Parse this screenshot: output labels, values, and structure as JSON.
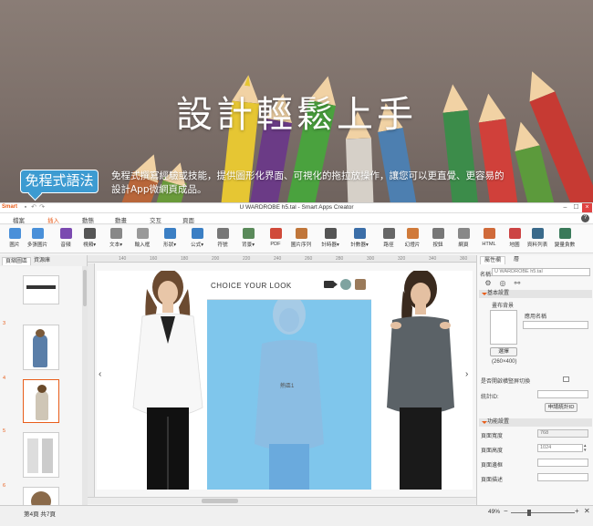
{
  "hero": {
    "title": "設計輕鬆上手",
    "badge": "免程式語法",
    "description_line1": "免程式撰寫經驗或技能，提供圖形化界面、可視化的拖拉放操作，讓您可以更直覺、更容易的",
    "description_line2": "設計App微網頁成品。"
  },
  "window": {
    "logo": "Smart",
    "title": "U WARDROBE h5.tal - Smart Apps Creator",
    "help_icon": "?"
  },
  "menu_tabs": [
    "檔案",
    "插入",
    "動態",
    "動畫",
    "交互",
    "頁面"
  ],
  "ribbon": [
    {
      "label": "圖片",
      "icon": "image-icon",
      "color": "#4a90d9"
    },
    {
      "label": "多張圖片",
      "icon": "images-icon",
      "color": "#4a90d9"
    },
    {
      "label": "音頻",
      "icon": "music-icon",
      "color": "#7b4ab0"
    },
    {
      "label": "視頻▾",
      "icon": "video-icon",
      "color": "#555555"
    },
    {
      "label": "文本▾",
      "icon": "text-icon",
      "color": "#888888"
    },
    {
      "label": "輸入框",
      "icon": "input-box-icon",
      "color": "#999999"
    },
    {
      "label": "形狀▾",
      "icon": "shape-icon",
      "color": "#3b7fc4"
    },
    {
      "label": "公式▾",
      "icon": "formula-icon",
      "color": "#3b7fc4"
    },
    {
      "label": "符號",
      "icon": "omega-icon",
      "color": "#777777"
    },
    {
      "label": "背景▾",
      "icon": "background-icon",
      "color": "#5a8a5a"
    },
    {
      "label": "PDF",
      "icon": "pdf-icon",
      "color": "#d04a3a"
    },
    {
      "label": "圖片序列",
      "icon": "image-sequence-icon",
      "color": "#c0763a"
    },
    {
      "label": "計時器▾",
      "icon": "timer-icon",
      "color": "#555555"
    },
    {
      "label": "計數器▾",
      "icon": "counter-icon",
      "color": "#3b6ea8"
    },
    {
      "label": "路徑",
      "icon": "path-icon",
      "color": "#666666"
    },
    {
      "label": "幻燈片",
      "icon": "slideshow-icon",
      "color": "#d07a3a"
    },
    {
      "label": "按鈕",
      "icon": "button-icon",
      "color": "#777777"
    },
    {
      "label": "網頁",
      "icon": "webpage-icon",
      "color": "#888888"
    },
    {
      "label": "HTML",
      "icon": "html-icon",
      "color": "#d06a3a"
    },
    {
      "label": "地圖",
      "icon": "map-icon",
      "color": "#cc4444"
    },
    {
      "label": "資料列表",
      "icon": "data-list-icon",
      "color": "#3a6a8a"
    },
    {
      "label": "變量貪數",
      "icon": "variable-icon",
      "color": "#3a7a5a"
    }
  ],
  "ruler_ticks": [
    "140",
    "160",
    "180",
    "200",
    "220",
    "240",
    "260",
    "280",
    "300",
    "320",
    "340",
    "360"
  ],
  "left_panel": {
    "tabs": [
      "頁縮圖區",
      "資源庫"
    ],
    "thumb_numbers": [
      "3",
      "4",
      "5",
      "6"
    ]
  },
  "stage": {
    "header_text": "CHOICE YOUR LOOK",
    "hotspot_label": "熱區1",
    "prev_arrow": "‹",
    "next_arrow": "›"
  },
  "right_panel": {
    "tabs": [
      "屬性欄",
      "層"
    ],
    "name_label": "名稱:",
    "name_value": "U WARDROBE h5.tal",
    "section_basic": "基本設置",
    "bg_label": "畫布背景",
    "app_name_label": "應用名稱",
    "choose_button": "選擇",
    "size_hint": "(260×400)",
    "landscape_label": "是否開啟橫豎屏切換",
    "stat_id_label": "統計ID:",
    "get_stat_button": "申請統計ID",
    "section_func": "功能設置",
    "width_label": "頁面寬度",
    "width_value": "768",
    "height_label": "頁面高度",
    "height_value": "1024",
    "margin_label": "頁面邊框",
    "desc_label": "頁面描述"
  },
  "status": {
    "page_info": "第4頁  共7頁",
    "zoom": "49%"
  },
  "colors": {
    "accent": "#e85d1a",
    "hero_badge": "#3d9bd1",
    "hotspot": "#7fc6ec"
  }
}
